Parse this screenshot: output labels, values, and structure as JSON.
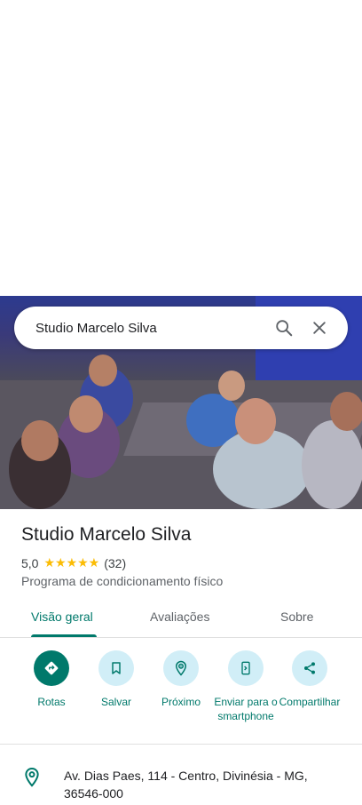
{
  "search": {
    "query": "Studio Marcelo Silva"
  },
  "place": {
    "name": "Studio Marcelo Silva",
    "rating": "5,0",
    "stars": "★★★★★",
    "review_count": "(32)",
    "category": "Programa de condicionamento físico"
  },
  "tabs": [
    {
      "label": "Visão geral"
    },
    {
      "label": "Avaliações"
    },
    {
      "label": "Sobre"
    }
  ],
  "actions": [
    {
      "label": "Rotas"
    },
    {
      "label": "Salvar"
    },
    {
      "label": "Próximo"
    },
    {
      "label": "Enviar para o smartphone"
    },
    {
      "label": "Compartilhar"
    }
  ],
  "address": {
    "text": "Av. Dias Paes, 114 - Centro, Divinésia - MG, 36546-000"
  },
  "colors": {
    "accent": "#00796b",
    "action_bg": "#d1eef7",
    "star": "#fbbc04"
  }
}
